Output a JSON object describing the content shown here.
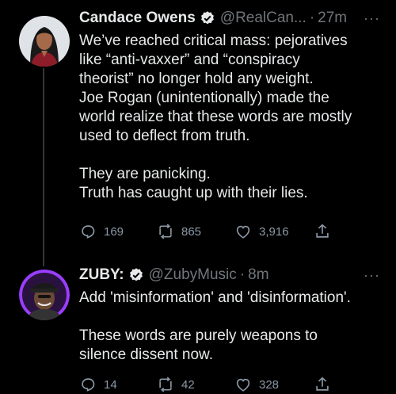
{
  "tweets": [
    {
      "author": "Candace Owens",
      "handle": "@RealCan...",
      "separator": "·",
      "time": "27m",
      "more": "···",
      "body_lines": [
        "We’ve reached critical mass: pejoratives",
        "like “anti-vaxxer” and “conspiracy",
        "theorist” no longer hold any weight.",
        "Joe Rogan (unintentionally) made the",
        "world realize that these words are mostly",
        "used to deflect from truth.",
        "",
        "They are panicking.",
        "Truth has caught up with their lies."
      ],
      "replies": "169",
      "retweets": "865",
      "likes": "3,916"
    },
    {
      "author": "ZUBY:",
      "handle": "@ZubyMusic",
      "separator": "·",
      "time": "8m",
      "more": "···",
      "body_lines": [
        "Add 'misinformation' and 'disinformation'.",
        "",
        "These words are purely weapons to",
        "silence dissent now."
      ],
      "replies": "14",
      "retweets": "42",
      "likes": "328"
    }
  ],
  "colors": {
    "background": "#000000",
    "text": "#e7e9ea",
    "muted": "#71767b",
    "verified": "#e7e9ea",
    "zuby_avatar_ring": "#9b3dff"
  }
}
